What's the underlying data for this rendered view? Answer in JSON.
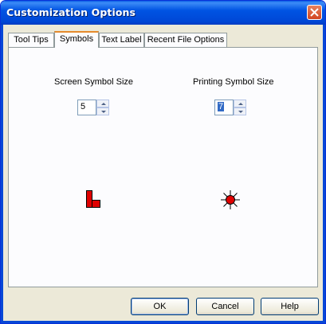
{
  "window": {
    "title": "Customization Options"
  },
  "tabs": [
    {
      "label": "Tool Tips",
      "active": false
    },
    {
      "label": "Symbols",
      "active": true
    },
    {
      "label": "Text Label",
      "active": false
    },
    {
      "label": "Recent File Options",
      "active": false
    }
  ],
  "symbols": {
    "screen": {
      "label": "Screen Symbol Size",
      "value": "5",
      "preview_icon": "building-marker-icon",
      "color": "#e00000"
    },
    "printing": {
      "label": "Printing Symbol Size",
      "value": "7",
      "preview_icon": "sun-marker-icon",
      "color": "#e00000"
    }
  },
  "buttons": {
    "ok": "OK",
    "cancel": "Cancel",
    "help": "Help"
  },
  "colors": {
    "title_bar": "#0054e3",
    "tab_highlight": "#e68b2c",
    "dialog_bg": "#ece9d8"
  }
}
